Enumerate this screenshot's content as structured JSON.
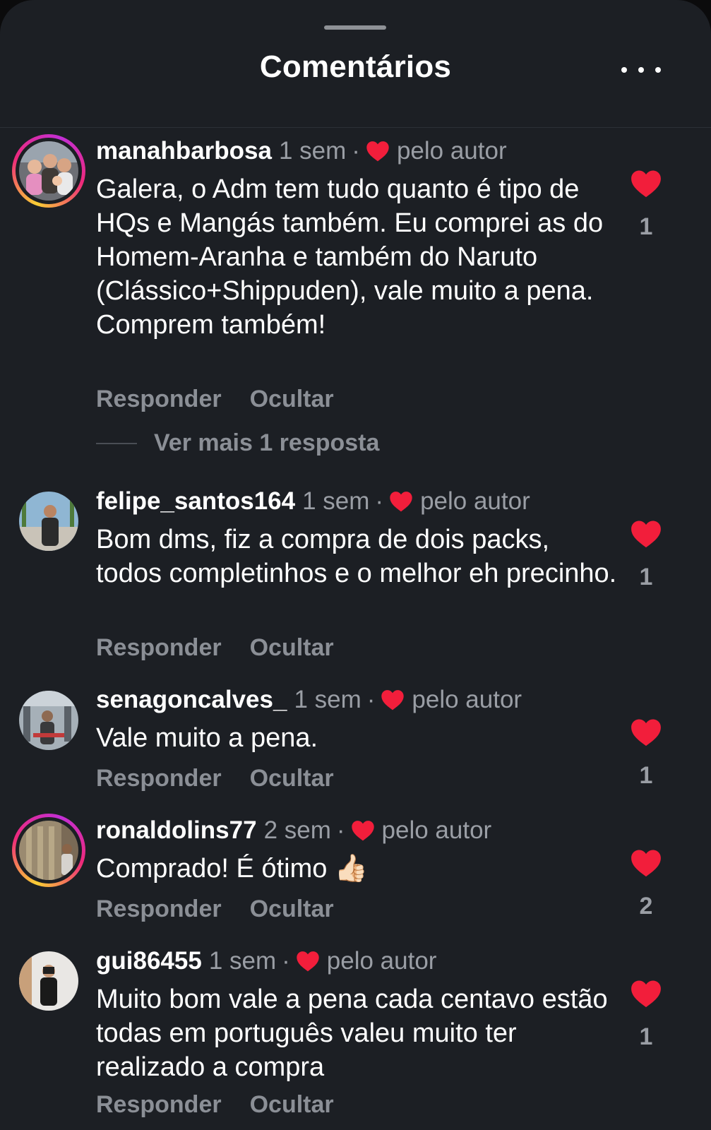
{
  "header": {
    "title": "Comentários",
    "more_icon": "more-horizontal-icon"
  },
  "colors": {
    "background": "#1c1f24",
    "heart": "#f21e3b",
    "secondary_text": "#9a9ea5"
  },
  "comments": [
    {
      "username": "manahbarbosa",
      "time": "1 sem",
      "liked_by_author": "pelo autor",
      "text": "Galera, o Adm tem tudo quanto é tipo de HQs e Mangás também. Eu comprei as do Homem-Aranha e também do Naruto (Clássico+Shippuden), vale muito a pena. Comprem também!",
      "reply_label": "Responder",
      "hide_label": "Ocultar",
      "likes": "1",
      "more_replies": "Ver mais 1 resposta",
      "has_story_ring": true
    },
    {
      "username": "felipe_santos164",
      "time": "1 sem",
      "liked_by_author": "pelo autor",
      "text": "Bom dms, fiz a compra de dois packs, todos completinhos e o melhor eh precinho.",
      "reply_label": "Responder",
      "hide_label": "Ocultar",
      "likes": "1",
      "has_story_ring": false
    },
    {
      "username": "senagoncalves_",
      "time": "1 sem",
      "liked_by_author": "pelo autor",
      "text": "Vale muito a pena.",
      "reply_label": "Responder",
      "hide_label": "Ocultar",
      "likes": "1",
      "has_story_ring": false
    },
    {
      "username": "ronaldolins77",
      "time": "2 sem",
      "liked_by_author": "pelo autor",
      "text": "Comprado! É ótimo 👍🏻",
      "reply_label": "Responder",
      "hide_label": "Ocultar",
      "likes": "2",
      "has_story_ring": true
    },
    {
      "username": "gui86455",
      "time": "1 sem",
      "liked_by_author": "pelo autor",
      "text": "Muito bom vale a pena cada centavo estão todas em português valeu muito ter realizado a compra",
      "reply_label": "Responder",
      "hide_label": "Ocultar",
      "likes": "1",
      "has_story_ring": false
    }
  ]
}
